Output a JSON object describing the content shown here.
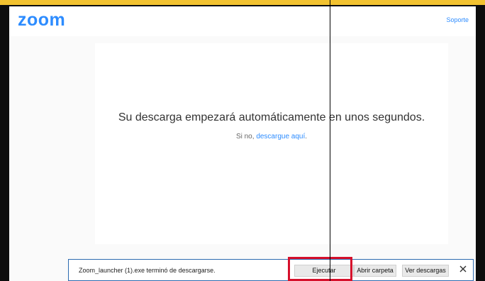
{
  "header": {
    "logo": "zoom",
    "support_link": "Soporte"
  },
  "main": {
    "message": "Su descarga empezará automáticamente en unos segundos.",
    "sub_prefix": "Si no,",
    "sub_link": "descargue aquí",
    "sub_suffix": "."
  },
  "download_bar": {
    "file_message": "Zoom_launcher (1).exe terminó de descargarse.",
    "run_label": "Ejecutar",
    "open_folder_label": "Abrir carpeta",
    "view_downloads_label": "Ver descargas",
    "close_icon": "close-icon"
  },
  "colors": {
    "accent": "#2d8cff",
    "highlight": "#d6102b",
    "top_strip": "#f2c230"
  }
}
